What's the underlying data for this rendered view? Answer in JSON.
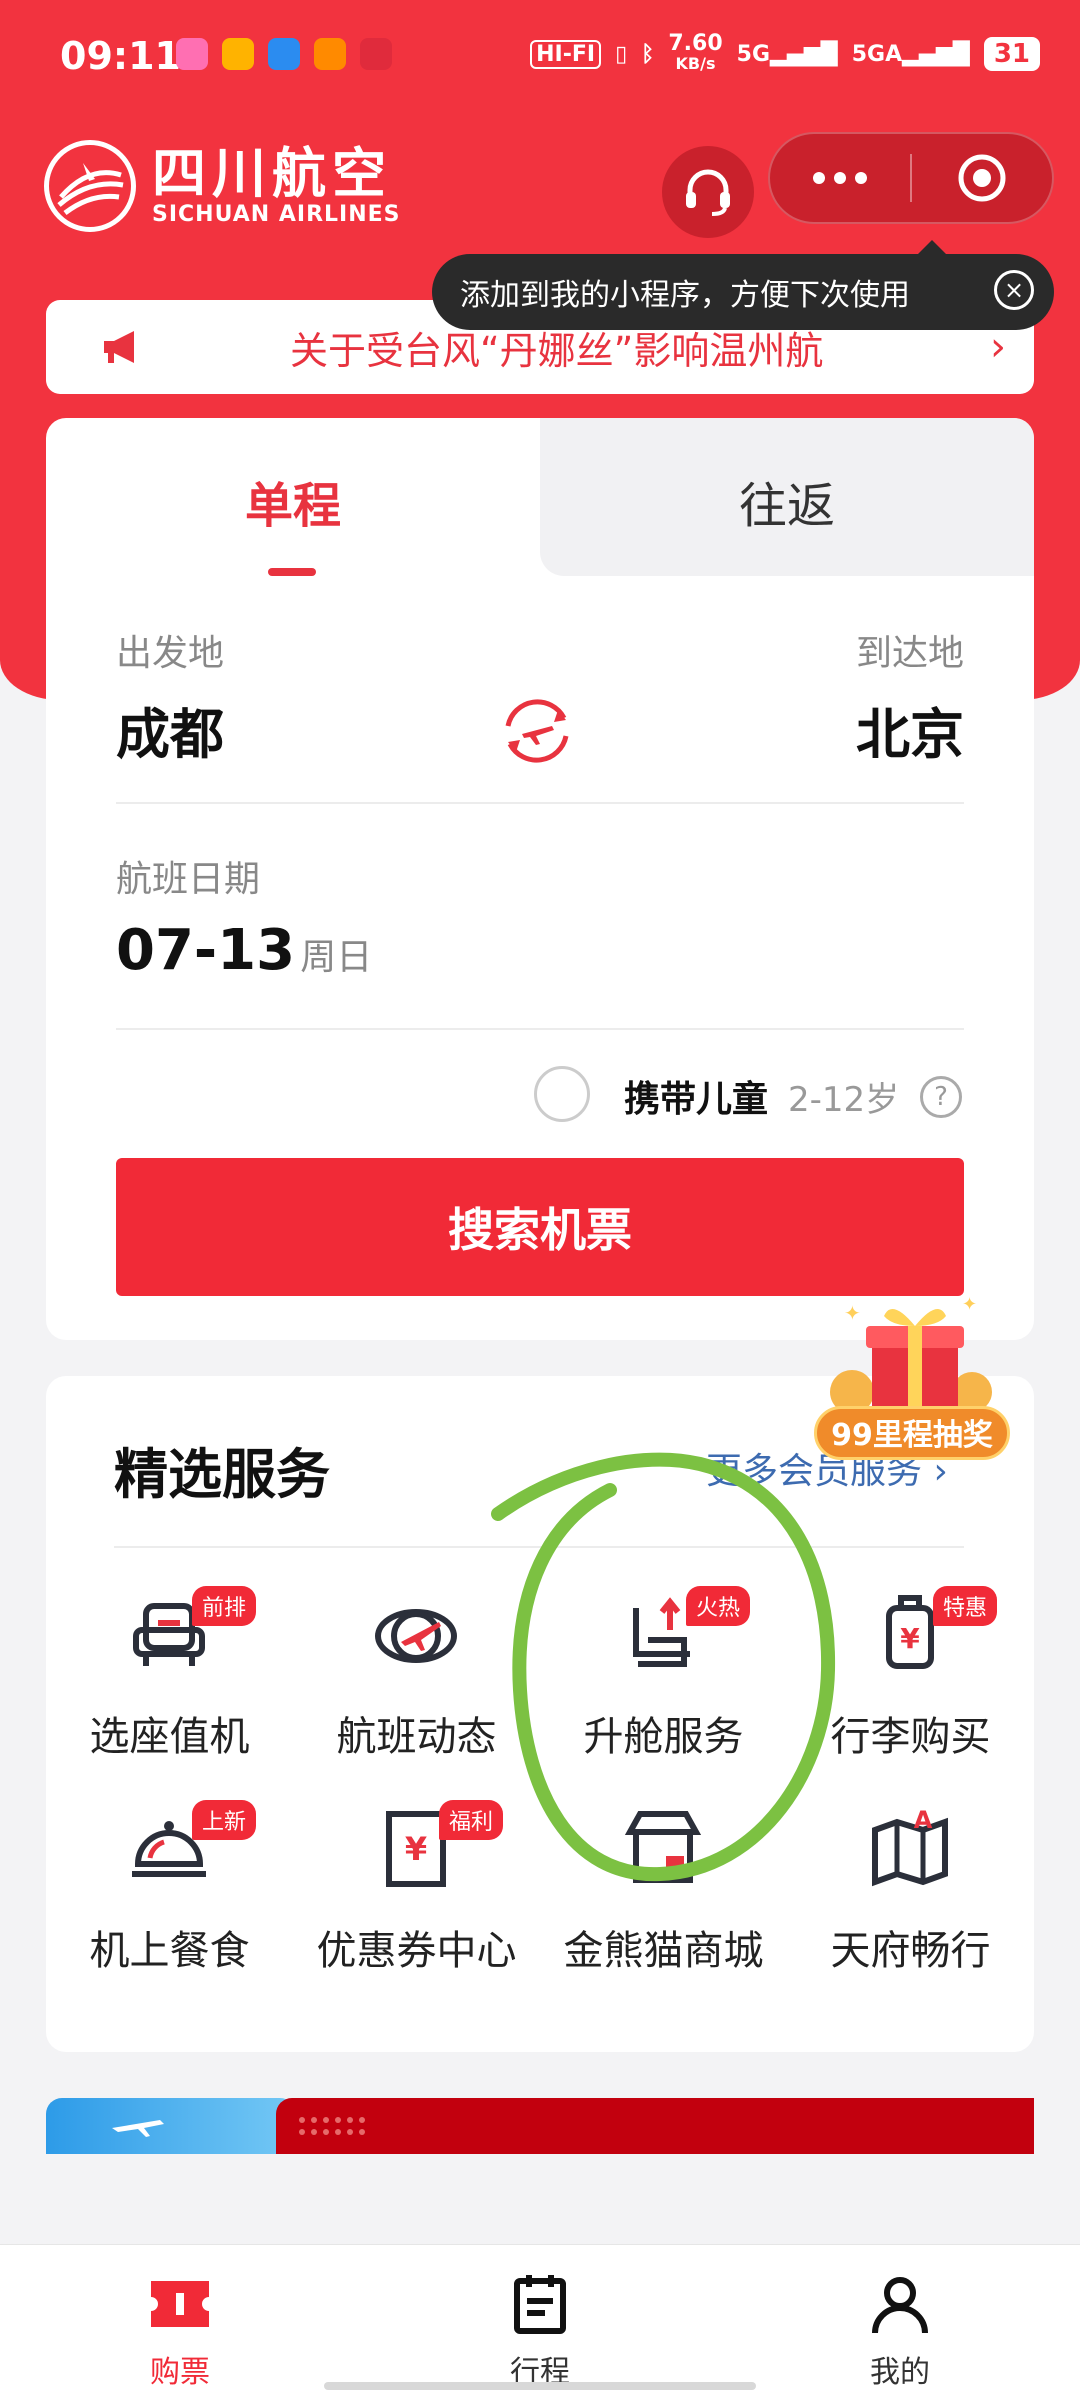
{
  "status_bar": {
    "time": "09:11",
    "hifi": "HI-FI",
    "net_speed": "7.60",
    "net_unit": "KB/s",
    "sim1": "5G",
    "sim2": "5GA",
    "battery": "31",
    "app_icon_colors": [
      "#ff6fb2",
      "#ffb300",
      "#2b8cf0",
      "#ff8a00",
      "#e02b3c"
    ]
  },
  "header": {
    "logo_cn": "四川航空",
    "logo_en": "SICHUAN AIRLINES",
    "service_icon": "headset-icon",
    "capsule_more_icon": "more-dots-icon",
    "capsule_close_icon": "target-circle-icon"
  },
  "tooltip": {
    "text": "添加到我的小程序，方便下次使用",
    "close": "×"
  },
  "notice": {
    "icon": "megaphone-icon",
    "text": "关于受台风“丹娜丝”影响温州航",
    "arrow": "›"
  },
  "booking": {
    "tabs": {
      "single": "单程",
      "return": "往返"
    },
    "depart_label": "出发地",
    "arrive_label": "到达地",
    "depart_city": "成都",
    "arrive_city": "北京",
    "swap_icon": "swap-plane-icon",
    "date_label": "航班日期",
    "date": "07-13",
    "weekday": "周日",
    "child_label": "携带儿童",
    "child_age": "2-12岁",
    "help": "?",
    "search_button": "搜索机票"
  },
  "promo": {
    "label": "99里程抽奖",
    "icon": "gift-box-icon"
  },
  "services": {
    "title": "精选服务",
    "more": "更多会员服务 ›",
    "items": [
      {
        "label": "选座值机",
        "badge": "前排",
        "icon": "seat-checkin-icon"
      },
      {
        "label": "航班动态",
        "badge": "",
        "icon": "flight-status-icon"
      },
      {
        "label": "升舱服务",
        "badge": "火热",
        "icon": "seat-upgrade-icon"
      },
      {
        "label": "行李购买",
        "badge": "特惠",
        "icon": "luggage-icon"
      },
      {
        "label": "机上餐食",
        "badge": "上新",
        "icon": "meal-cloche-icon"
      },
      {
        "label": "优惠券中心",
        "badge": "福利",
        "icon": "coupon-icon"
      },
      {
        "label": "金熊猫商城",
        "badge": "",
        "icon": "shop-icon"
      },
      {
        "label": "天府畅行",
        "badge": "",
        "icon": "map-icon"
      }
    ]
  },
  "tabbar": {
    "items": [
      {
        "label": "购票",
        "icon": "ticket-icon",
        "active": true
      },
      {
        "label": "行程",
        "icon": "itinerary-icon",
        "active": false
      },
      {
        "label": "我的",
        "icon": "profile-icon",
        "active": false
      }
    ]
  },
  "colors": {
    "brand_red": "#f2333f",
    "annotation_green": "#7cc142",
    "link_blue": "#3d6bb0"
  }
}
